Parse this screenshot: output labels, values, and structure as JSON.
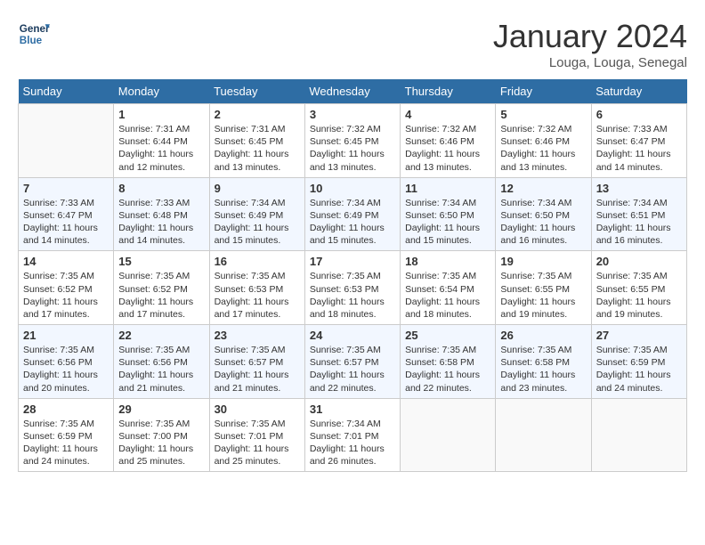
{
  "header": {
    "logo_text_general": "General",
    "logo_text_blue": "Blue",
    "month_title": "January 2024",
    "location": "Louga, Louga, Senegal"
  },
  "days_of_week": [
    "Sunday",
    "Monday",
    "Tuesday",
    "Wednesday",
    "Thursday",
    "Friday",
    "Saturday"
  ],
  "weeks": [
    [
      {
        "day": "",
        "content": ""
      },
      {
        "day": "1",
        "content": "Sunrise: 7:31 AM\nSunset: 6:44 PM\nDaylight: 11 hours and 12 minutes."
      },
      {
        "day": "2",
        "content": "Sunrise: 7:31 AM\nSunset: 6:45 PM\nDaylight: 11 hours and 13 minutes."
      },
      {
        "day": "3",
        "content": "Sunrise: 7:32 AM\nSunset: 6:45 PM\nDaylight: 11 hours and 13 minutes."
      },
      {
        "day": "4",
        "content": "Sunrise: 7:32 AM\nSunset: 6:46 PM\nDaylight: 11 hours and 13 minutes."
      },
      {
        "day": "5",
        "content": "Sunrise: 7:32 AM\nSunset: 6:46 PM\nDaylight: 11 hours and 13 minutes."
      },
      {
        "day": "6",
        "content": "Sunrise: 7:33 AM\nSunset: 6:47 PM\nDaylight: 11 hours and 14 minutes."
      }
    ],
    [
      {
        "day": "7",
        "content": "Sunrise: 7:33 AM\nSunset: 6:47 PM\nDaylight: 11 hours and 14 minutes."
      },
      {
        "day": "8",
        "content": "Sunrise: 7:33 AM\nSunset: 6:48 PM\nDaylight: 11 hours and 14 minutes."
      },
      {
        "day": "9",
        "content": "Sunrise: 7:34 AM\nSunset: 6:49 PM\nDaylight: 11 hours and 15 minutes."
      },
      {
        "day": "10",
        "content": "Sunrise: 7:34 AM\nSunset: 6:49 PM\nDaylight: 11 hours and 15 minutes."
      },
      {
        "day": "11",
        "content": "Sunrise: 7:34 AM\nSunset: 6:50 PM\nDaylight: 11 hours and 15 minutes."
      },
      {
        "day": "12",
        "content": "Sunrise: 7:34 AM\nSunset: 6:50 PM\nDaylight: 11 hours and 16 minutes."
      },
      {
        "day": "13",
        "content": "Sunrise: 7:34 AM\nSunset: 6:51 PM\nDaylight: 11 hours and 16 minutes."
      }
    ],
    [
      {
        "day": "14",
        "content": "Sunrise: 7:35 AM\nSunset: 6:52 PM\nDaylight: 11 hours and 17 minutes."
      },
      {
        "day": "15",
        "content": "Sunrise: 7:35 AM\nSunset: 6:52 PM\nDaylight: 11 hours and 17 minutes."
      },
      {
        "day": "16",
        "content": "Sunrise: 7:35 AM\nSunset: 6:53 PM\nDaylight: 11 hours and 17 minutes."
      },
      {
        "day": "17",
        "content": "Sunrise: 7:35 AM\nSunset: 6:53 PM\nDaylight: 11 hours and 18 minutes."
      },
      {
        "day": "18",
        "content": "Sunrise: 7:35 AM\nSunset: 6:54 PM\nDaylight: 11 hours and 18 minutes."
      },
      {
        "day": "19",
        "content": "Sunrise: 7:35 AM\nSunset: 6:55 PM\nDaylight: 11 hours and 19 minutes."
      },
      {
        "day": "20",
        "content": "Sunrise: 7:35 AM\nSunset: 6:55 PM\nDaylight: 11 hours and 19 minutes."
      }
    ],
    [
      {
        "day": "21",
        "content": "Sunrise: 7:35 AM\nSunset: 6:56 PM\nDaylight: 11 hours and 20 minutes."
      },
      {
        "day": "22",
        "content": "Sunrise: 7:35 AM\nSunset: 6:56 PM\nDaylight: 11 hours and 21 minutes."
      },
      {
        "day": "23",
        "content": "Sunrise: 7:35 AM\nSunset: 6:57 PM\nDaylight: 11 hours and 21 minutes."
      },
      {
        "day": "24",
        "content": "Sunrise: 7:35 AM\nSunset: 6:57 PM\nDaylight: 11 hours and 22 minutes."
      },
      {
        "day": "25",
        "content": "Sunrise: 7:35 AM\nSunset: 6:58 PM\nDaylight: 11 hours and 22 minutes."
      },
      {
        "day": "26",
        "content": "Sunrise: 7:35 AM\nSunset: 6:58 PM\nDaylight: 11 hours and 23 minutes."
      },
      {
        "day": "27",
        "content": "Sunrise: 7:35 AM\nSunset: 6:59 PM\nDaylight: 11 hours and 24 minutes."
      }
    ],
    [
      {
        "day": "28",
        "content": "Sunrise: 7:35 AM\nSunset: 6:59 PM\nDaylight: 11 hours and 24 minutes."
      },
      {
        "day": "29",
        "content": "Sunrise: 7:35 AM\nSunset: 7:00 PM\nDaylight: 11 hours and 25 minutes."
      },
      {
        "day": "30",
        "content": "Sunrise: 7:35 AM\nSunset: 7:01 PM\nDaylight: 11 hours and 25 minutes."
      },
      {
        "day": "31",
        "content": "Sunrise: 7:34 AM\nSunset: 7:01 PM\nDaylight: 11 hours and 26 minutes."
      },
      {
        "day": "",
        "content": ""
      },
      {
        "day": "",
        "content": ""
      },
      {
        "day": "",
        "content": ""
      }
    ]
  ]
}
